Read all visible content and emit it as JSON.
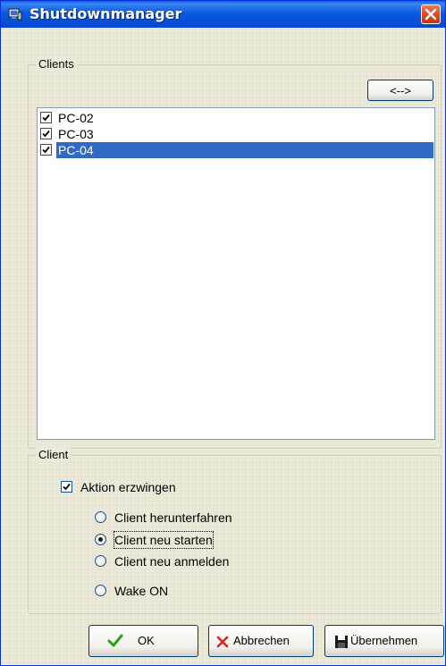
{
  "window": {
    "title": "Shutdownmanager",
    "accent_color": "#0b59e0",
    "close_icon": "close-icon"
  },
  "clients_group": {
    "legend": "Clients",
    "toggle_button_label": "<-->",
    "items": [
      {
        "label": "PC-02",
        "checked": true,
        "selected": false
      },
      {
        "label": "PC-03",
        "checked": true,
        "selected": false
      },
      {
        "label": "PC-04",
        "checked": true,
        "selected": true
      }
    ],
    "selection_color": "#316ac5"
  },
  "client_group": {
    "legend": "Client",
    "force_action": {
      "label": "Aktion erzwingen",
      "checked": true
    },
    "options": [
      {
        "label": "Client herunterfahren",
        "selected": false
      },
      {
        "label": "Client neu starten",
        "selected": true
      },
      {
        "label": "Client neu anmelden",
        "selected": false
      },
      {
        "label": "Wake ON",
        "selected": false
      }
    ]
  },
  "buttons": {
    "ok": {
      "label": "OK",
      "icon": "checkmark-icon",
      "icon_color": "#2e9e1f"
    },
    "cancel": {
      "label": "Abbrechen",
      "icon": "x-icon",
      "icon_color": "#e0231c"
    },
    "apply": {
      "label": "Übernehmen",
      "icon": "floppy-disk-icon",
      "icon_color": "#1a1a1a"
    }
  }
}
